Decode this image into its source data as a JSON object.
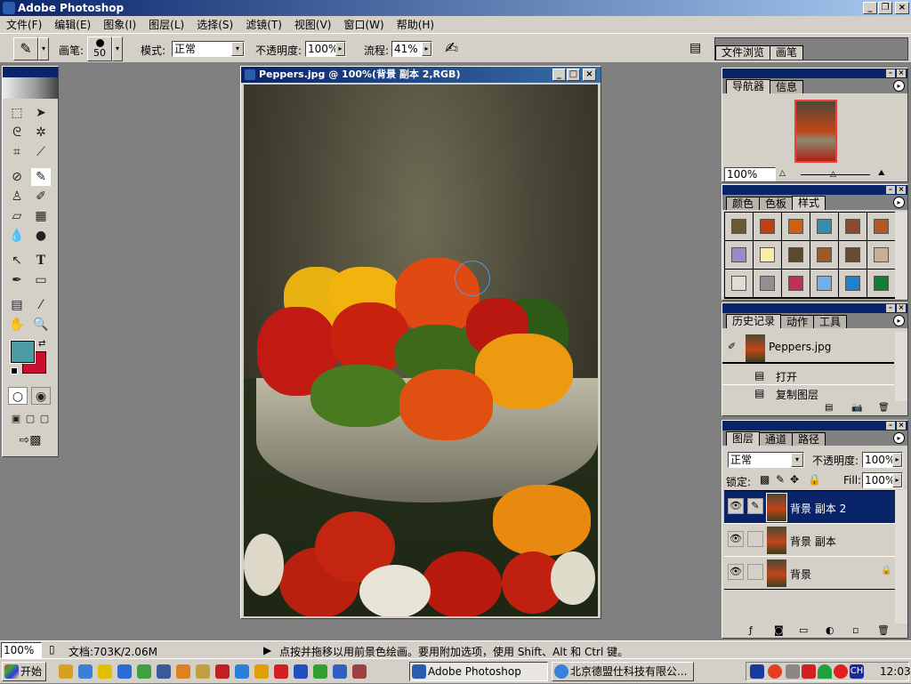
{
  "app": {
    "title": "Adobe Photoshop"
  },
  "menu": [
    "文件(F)",
    "编辑(E)",
    "图象(I)",
    "图层(L)",
    "选择(S)",
    "滤镜(T)",
    "视图(V)",
    "窗口(W)",
    "帮助(H)"
  ],
  "options": {
    "brush_label": "画笔:",
    "brush_size": "50",
    "mode_label": "模式:",
    "mode_value": "正常",
    "opacity_label": "不透明度:",
    "opacity_value": "100%",
    "flow_label": "流程:",
    "flow_value": "41%"
  },
  "palette_well": {
    "tabs": [
      "文件浏览",
      "画笔"
    ]
  },
  "colors": {
    "foreground": "#4a9ba3",
    "background": "#c8102e"
  },
  "document": {
    "title": "Peppers.jpg @ 100%(背景 副本 2,RGB)"
  },
  "navigator": {
    "tabs": [
      "导航器",
      "信息"
    ],
    "zoom": "100%"
  },
  "styles_panel": {
    "tabs": [
      "颜色",
      "色板",
      "样式"
    ]
  },
  "history": {
    "tabs": [
      "历史记录",
      "动作",
      "工具"
    ],
    "snapshot": "Peppers.jpg",
    "items": [
      "打开",
      "复制图层"
    ]
  },
  "layers": {
    "tabs": [
      "图层",
      "通道",
      "路径"
    ],
    "blend_mode": "正常",
    "opacity_label": "不透明度:",
    "opacity": "100%",
    "lock_label": "锁定:",
    "fill_label": "Fill:",
    "fill": "100%",
    "items": [
      {
        "name": "背景 副本 2",
        "selected": true
      },
      {
        "name": "背景 副本",
        "selected": false
      },
      {
        "name": "背景",
        "selected": false,
        "locked": true
      }
    ]
  },
  "status": {
    "zoom": "100%",
    "doc_info": "文档:703K/2.06M",
    "hint": "点按并拖移以用前景色绘画。要用附加选项，使用 Shift、Alt 和 Ctrl 键。"
  },
  "taskbar": {
    "start": "开始",
    "tasks": [
      "Adobe Photoshop",
      "北京德盟仕科技有限公..."
    ],
    "tray_lang": "CH",
    "clock": "12:03"
  }
}
